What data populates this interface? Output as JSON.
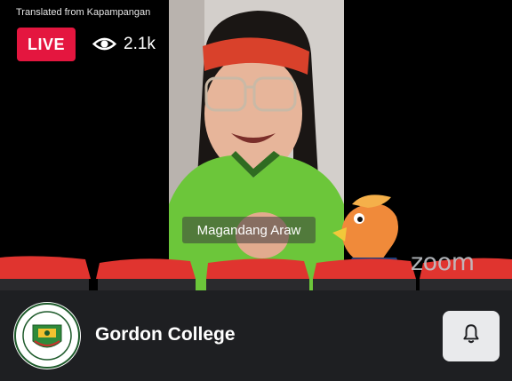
{
  "overlay": {
    "translated_label": "Translated from Kapampangan",
    "live_label": "LIVE",
    "viewer_count": "2.1k",
    "viewer_icon": "eye-icon"
  },
  "video": {
    "caption": "Magandang Araw",
    "watermark": "zoom"
  },
  "footer": {
    "channel_name": "Gordon College",
    "logo_icon": "gordon-college-seal",
    "notify_icon": "bell-icon"
  },
  "colors": {
    "live_red": "#e4163f",
    "footer_bg": "#1e1f22",
    "seat_red": "#e0342f",
    "bell_button_bg": "#e9eaec"
  }
}
